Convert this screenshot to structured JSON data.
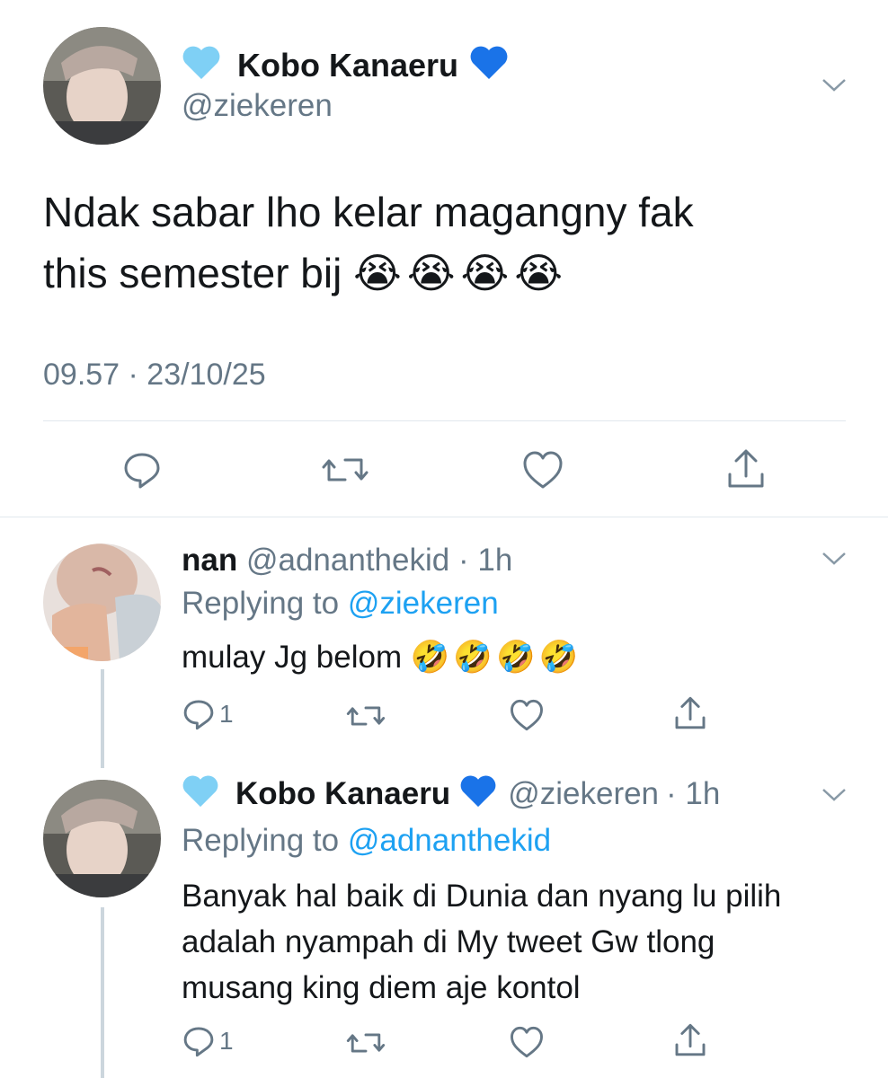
{
  "main_tweet": {
    "display_name": "Kobo Kanaeru",
    "handle": "@ziekeren",
    "text_line1": "Ndak sabar lho kelar magangny fak",
    "text_line2": "this semester bij",
    "emojis": "😭😭😭😭",
    "timestamp": "09.57 · 23/10/25",
    "icons": [
      "light-blue-heart",
      "blue-heart",
      "chevron-down",
      "reply",
      "retweet",
      "like",
      "share"
    ]
  },
  "reply1": {
    "display_name": "nan",
    "handle": "@adnanthekid",
    "time": "· 1h",
    "replying_prefix": "Replying to",
    "replying_to": "@ziekeren",
    "text": "mulay Jg belom",
    "emojis": "🤣🤣🤣🤣",
    "reply_count": "1"
  },
  "reply2": {
    "display_name": "Kobo Kanaeru",
    "handle": "@ziekeren",
    "time": "· 1h",
    "replying_prefix": "Replying to",
    "replying_to": "@adnanthekid",
    "text_line1": "Banyak hal baik di Dunia dan nyang lu pilih",
    "text_line2": "adalah nyampah di My tweet Gw tlong",
    "text_line3": "musang king diem aje kontol",
    "reply_count": "1"
  },
  "colors": {
    "accent": "#1da1f2",
    "secondary_text": "#657786",
    "divider": "#e1e8ed",
    "light_blue_heart": "#7fd0f5",
    "blue_heart": "#1a73e8"
  }
}
